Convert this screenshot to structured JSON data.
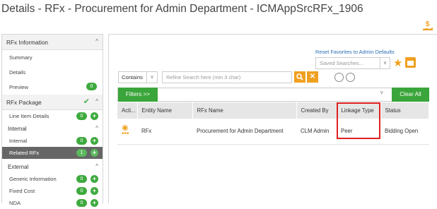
{
  "page": {
    "title": "Details - RFx - Procurement for Admin Department - ICMAppSrcRFx_1906"
  },
  "icons": {
    "corner": "dollar-hand-icon",
    "star": "star-icon",
    "calendar": "calendar-icon"
  },
  "sidebar": {
    "rfx_info": {
      "label": "RFx Information",
      "items": [
        {
          "label": "Summary"
        },
        {
          "label": "Details"
        },
        {
          "label": "Preview",
          "count": "0"
        }
      ]
    },
    "rfx_package": {
      "label": "RFx Package",
      "items": [
        {
          "label": "Line Item Details",
          "count": "0"
        }
      ]
    },
    "internal": {
      "label": "Internal",
      "items": [
        {
          "label": "Internal",
          "count": "0"
        },
        {
          "label": "Related RFx",
          "count": "1"
        }
      ]
    },
    "external": {
      "label": "External",
      "items": [
        {
          "label": "Generic Information",
          "count": "0"
        },
        {
          "label": "Fixed Cost",
          "count": "0"
        },
        {
          "label": "NDA",
          "count": "0"
        }
      ]
    }
  },
  "toolbar": {
    "reset_link": "Reset Favorites to Admin Defaults",
    "saved_placeholder": "Saved Searches...",
    "contains_value": "Contains",
    "search_placeholder": "Refine Search here (min 3 char)",
    "filters_label": "Filters >>",
    "clear_label": "Clear All"
  },
  "table": {
    "headers": [
      "Acti...",
      "Entity Name",
      "RFx Name",
      "Created By",
      "Linkage Type",
      "Status"
    ],
    "rows": [
      {
        "entity": "RFx",
        "rfx_name": "Procurement for Admin Department",
        "created_by": "CLM Admin",
        "linkage": "Peer",
        "status": "Bidding Open"
      }
    ]
  },
  "colors": {
    "accent_green": "#3aa53a",
    "accent_orange": "#f0a020",
    "highlight_red": "#e02020",
    "link_blue": "#2a6fb5"
  }
}
